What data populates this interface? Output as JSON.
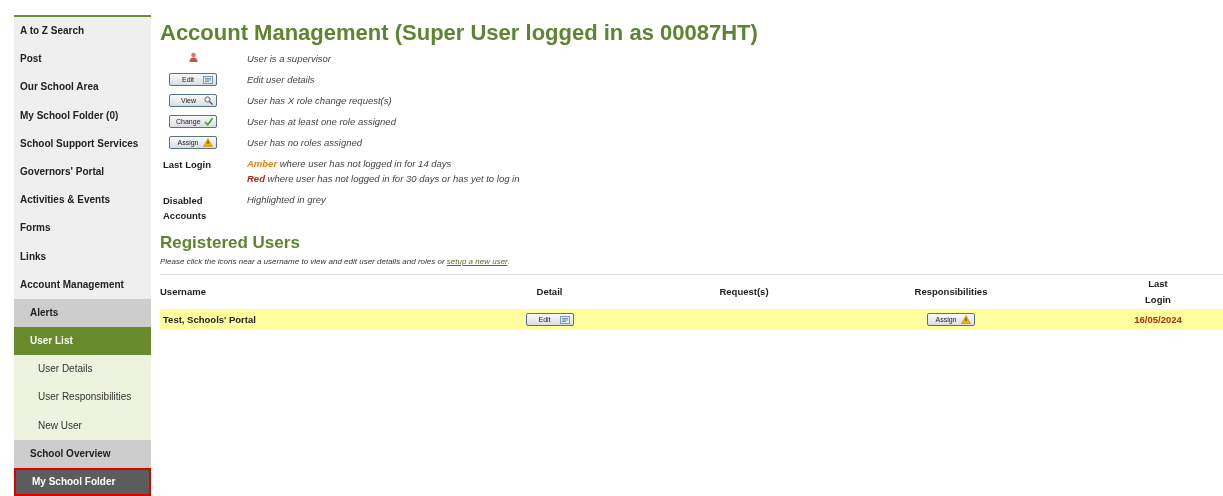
{
  "sidebar": {
    "items": [
      {
        "label": "A to Z Search",
        "kind": "section",
        "selected": false
      },
      {
        "label": "Post",
        "kind": "section",
        "selected": false
      },
      {
        "label": "Our School Area",
        "kind": "section",
        "selected": false
      },
      {
        "label": "My School Folder (0)",
        "kind": "section",
        "selected": false
      },
      {
        "label": "School Support Services",
        "kind": "section",
        "selected": false
      },
      {
        "label": "Governors' Portal",
        "kind": "section",
        "selected": false
      },
      {
        "label": "Activities & Events",
        "kind": "section",
        "selected": false
      },
      {
        "label": "Forms",
        "kind": "section",
        "selected": false
      },
      {
        "label": "Links",
        "kind": "section",
        "selected": false
      },
      {
        "label": "Account Management",
        "kind": "section",
        "selected": false
      },
      {
        "label": "Alerts",
        "kind": "sub",
        "selected": false
      },
      {
        "label": "User List",
        "kind": "sub",
        "selected": true
      },
      {
        "label": "User Details",
        "kind": "leaf",
        "selected": false
      },
      {
        "label": "User Responsibilities",
        "kind": "leaf",
        "selected": false
      },
      {
        "label": "New User",
        "kind": "leaf",
        "selected": false
      },
      {
        "label": "School Overview",
        "kind": "sub",
        "selected": false
      },
      {
        "label": "My School Folder",
        "kind": "folder",
        "selected": false
      }
    ]
  },
  "title": "Account Management (Super User logged in as 00087HT)",
  "legend": [
    {
      "kind": "supervisor",
      "notes": [
        {
          "text": "User is a supervisor"
        }
      ]
    },
    {
      "kind": "button",
      "button": {
        "label": "Edit",
        "kind": "edit"
      },
      "notes": [
        {
          "text": "Edit user details"
        }
      ]
    },
    {
      "kind": "button",
      "button": {
        "label": "View",
        "kind": "view"
      },
      "notes": [
        {
          "text": "User has X role change request(s)"
        }
      ]
    },
    {
      "kind": "button",
      "button": {
        "label": "Change",
        "kind": "change"
      },
      "notes": [
        {
          "text": "User has at least one role assigned"
        }
      ]
    },
    {
      "kind": "button",
      "button": {
        "label": "Assign",
        "kind": "assign"
      },
      "notes": [
        {
          "text": "User has no roles assigned"
        }
      ]
    },
    {
      "kind": "label",
      "label": "Last Login",
      "notes": [
        {
          "text": "**Amber** where user has not logged in for 14 days",
          "color": "#e8820c"
        },
        {
          "text": "**Red** where user has not logged in for 30 days or has yet to log in",
          "color": "#b22a10"
        }
      ]
    },
    {
      "kind": "label",
      "label": "Disabled Accounts",
      "notes": [
        {
          "text": "Highlighted in grey"
        }
      ]
    }
  ],
  "registered": {
    "heading": "Registered Users",
    "intro": "Please click the icons near a username to view and edit user details and roles or ",
    "link": "setup a new user",
    "after": ".",
    "columns": [
      "Username",
      "Detail",
      "Request(s)",
      "Responsibilities",
      "Last Login"
    ],
    "rows": [
      {
        "username": "Test, Schools' Portal",
        "detail": {
          "label": "Edit",
          "kind": "edit"
        },
        "responsibilities": {
          "label": "Assign",
          "kind": "assign"
        },
        "last_login": "16/05/2024",
        "color": "#b22a10"
      }
    ]
  }
}
